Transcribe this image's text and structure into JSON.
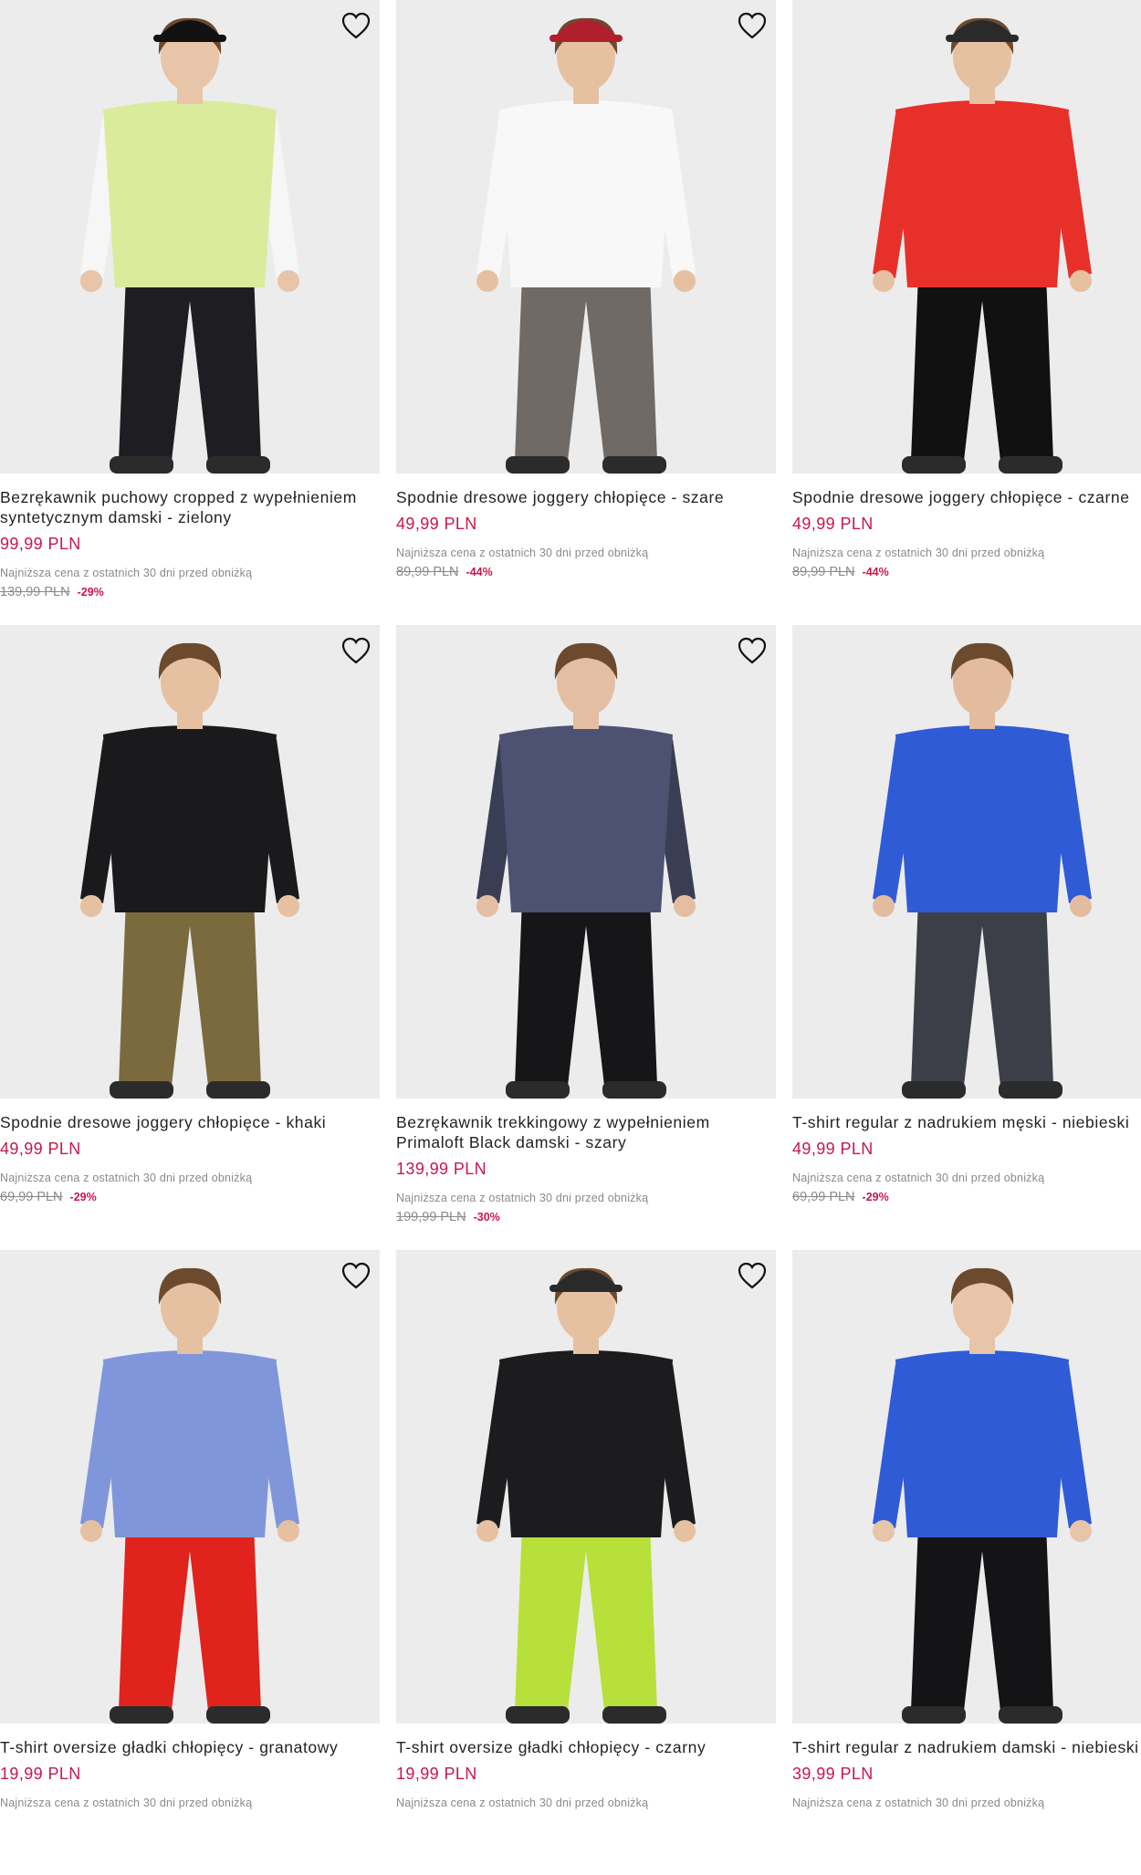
{
  "products": [
    {
      "name": "Bezrękawnik puchowy cropped z wypełnieniem syntetycznym damski - zielony",
      "price": "99,99 PLN",
      "lowest_label": "Najniższa cena z ostatnich 30 dni przed obniżką",
      "old_price": "139,99 PLN",
      "discount": "-29%",
      "colors": {
        "top": "#dbeb9c",
        "under": "#f6f6f6",
        "bottom": "#1e1e22",
        "hat": "#111111",
        "skin": "#e8c4a8"
      }
    },
    {
      "name": "Spodnie dresowe joggery chłopięce - szare",
      "price": "49,99 PLN",
      "lowest_label": "Najniższa cena z ostatnich 30 dni przed obniżką",
      "old_price": "89,99 PLN",
      "discount": "-44%",
      "colors": {
        "top": "#f8f8f8",
        "under": "#f8f8f8",
        "bottom": "#6f6a66",
        "hat": "#b0202c",
        "skin": "#e6c1a1"
      }
    },
    {
      "name": "Spodnie dresowe joggery chłopięce - czarne",
      "price": "49,99 PLN",
      "lowest_label": "Najniższa cena z ostatnich 30 dni przed obniżką",
      "old_price": "89,99 PLN",
      "discount": "-44%",
      "colors": {
        "top": "#e8302a",
        "under": "#e8302a",
        "bottom": "#111111",
        "hat": "#2a2a2a",
        "skin": "#e6c1a1"
      }
    },
    {
      "name": "Spodnie dresowe joggery chłopięce - khaki",
      "price": "49,99 PLN",
      "lowest_label": "Najniższa cena z ostatnich 30 dni przed obniżką",
      "old_price": "69,99 PLN",
      "discount": "-29%",
      "colors": {
        "top": "#1a1a1c",
        "under": "#1a1a1c",
        "bottom": "#7a6a3e",
        "hat": "none",
        "skin": "#e6c1a1"
      }
    },
    {
      "name": "Bezrękawnik trekkingowy z wypełnieniem Primaloft Black damski - szary",
      "price": "139,99 PLN",
      "lowest_label": "Najniższa cena z ostatnich 30 dni przed obniżką",
      "old_price": "199,99 PLN",
      "discount": "-30%",
      "colors": {
        "top": "#4d5272",
        "under": "#3a3e54",
        "bottom": "#161618",
        "hat": "none",
        "skin": "#e3bea2"
      }
    },
    {
      "name": "T-shirt regular z nadrukiem męski - niebieski",
      "price": "49,99 PLN",
      "lowest_label": "Najniższa cena z ostatnich 30 dni przed obniżką",
      "old_price": "69,99 PLN",
      "discount": "-29%",
      "colors": {
        "top": "#2f5bd6",
        "under": "#2f5bd6",
        "bottom": "#3c3f48",
        "hat": "none",
        "skin": "#e3bca0"
      }
    },
    {
      "name": "T-shirt oversize gładki chłopięcy - granatowy",
      "price": "19,99 PLN",
      "lowest_label": "Najniższa cena z ostatnich 30 dni przed obniżką",
      "old_price": "",
      "discount": "",
      "colors": {
        "top": "#7f96db",
        "under": "#7f96db",
        "bottom": "#e0231c",
        "hat": "none",
        "skin": "#e6c1a1"
      }
    },
    {
      "name": "T-shirt oversize gładki chłopięcy - czarny",
      "price": "19,99 PLN",
      "lowest_label": "Najniższa cena z ostatnich 30 dni przed obniżką",
      "old_price": "",
      "discount": "",
      "colors": {
        "top": "#1c1c1e",
        "under": "#1c1c1e",
        "bottom": "#b7e03a",
        "hat": "#2a2a2a",
        "skin": "#e6c1a1"
      }
    },
    {
      "name": "T-shirt regular z nadrukiem damski - niebieski",
      "price": "39,99 PLN",
      "lowest_label": "Najniższa cena z ostatnich 30 dni przed obniżką",
      "old_price": "",
      "discount": "",
      "colors": {
        "top": "#2f5bd6",
        "under": "#2f5bd6",
        "bottom": "#141416",
        "hat": "none",
        "skin": "#e8c4a8"
      }
    }
  ]
}
